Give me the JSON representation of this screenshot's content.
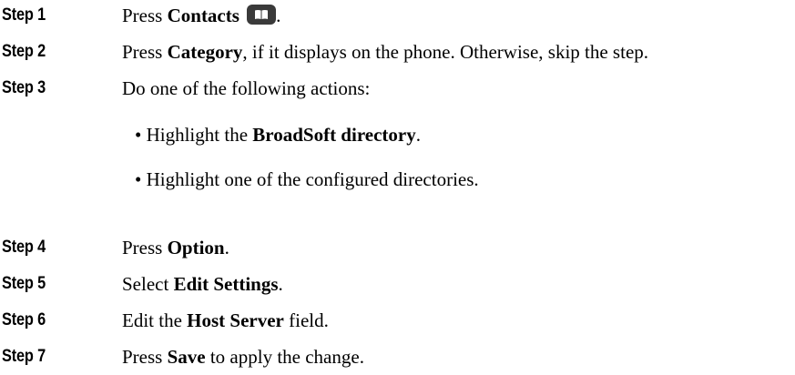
{
  "steps": [
    {
      "label": "Step 1",
      "parts": [
        {
          "t": "Press "
        },
        {
          "t": "Contacts",
          "b": true
        },
        {
          "t": " "
        },
        {
          "icon": "contacts-book-icon"
        },
        {
          "t": "."
        }
      ]
    },
    {
      "label": "Step 2",
      "parts": [
        {
          "t": "Press "
        },
        {
          "t": "Category",
          "b": true
        },
        {
          "t": ", if it displays on the phone. Otherwise, skip the step."
        }
      ]
    },
    {
      "label": "Step 3",
      "parts": [
        {
          "t": "Do one of the following actions:"
        }
      ],
      "bullets": [
        [
          {
            "t": "• Highlight the "
          },
          {
            "t": "BroadSoft directory",
            "b": true
          },
          {
            "t": "."
          }
        ],
        [
          {
            "t": "• Highlight one of the configured directories."
          }
        ]
      ]
    },
    {
      "label": "Step 4",
      "parts": [
        {
          "t": "Press "
        },
        {
          "t": "Option",
          "b": true
        },
        {
          "t": "."
        }
      ]
    },
    {
      "label": "Step 5",
      "parts": [
        {
          "t": "Select "
        },
        {
          "t": "Edit Settings",
          "b": true
        },
        {
          "t": "."
        }
      ]
    },
    {
      "label": "Step 6",
      "parts": [
        {
          "t": "Edit the "
        },
        {
          "t": "Host Server",
          "b": true
        },
        {
          "t": " field."
        }
      ]
    },
    {
      "label": "Step 7",
      "parts": [
        {
          "t": "Press "
        },
        {
          "t": "Save",
          "b": true
        },
        {
          "t": " to apply the change."
        }
      ]
    }
  ]
}
